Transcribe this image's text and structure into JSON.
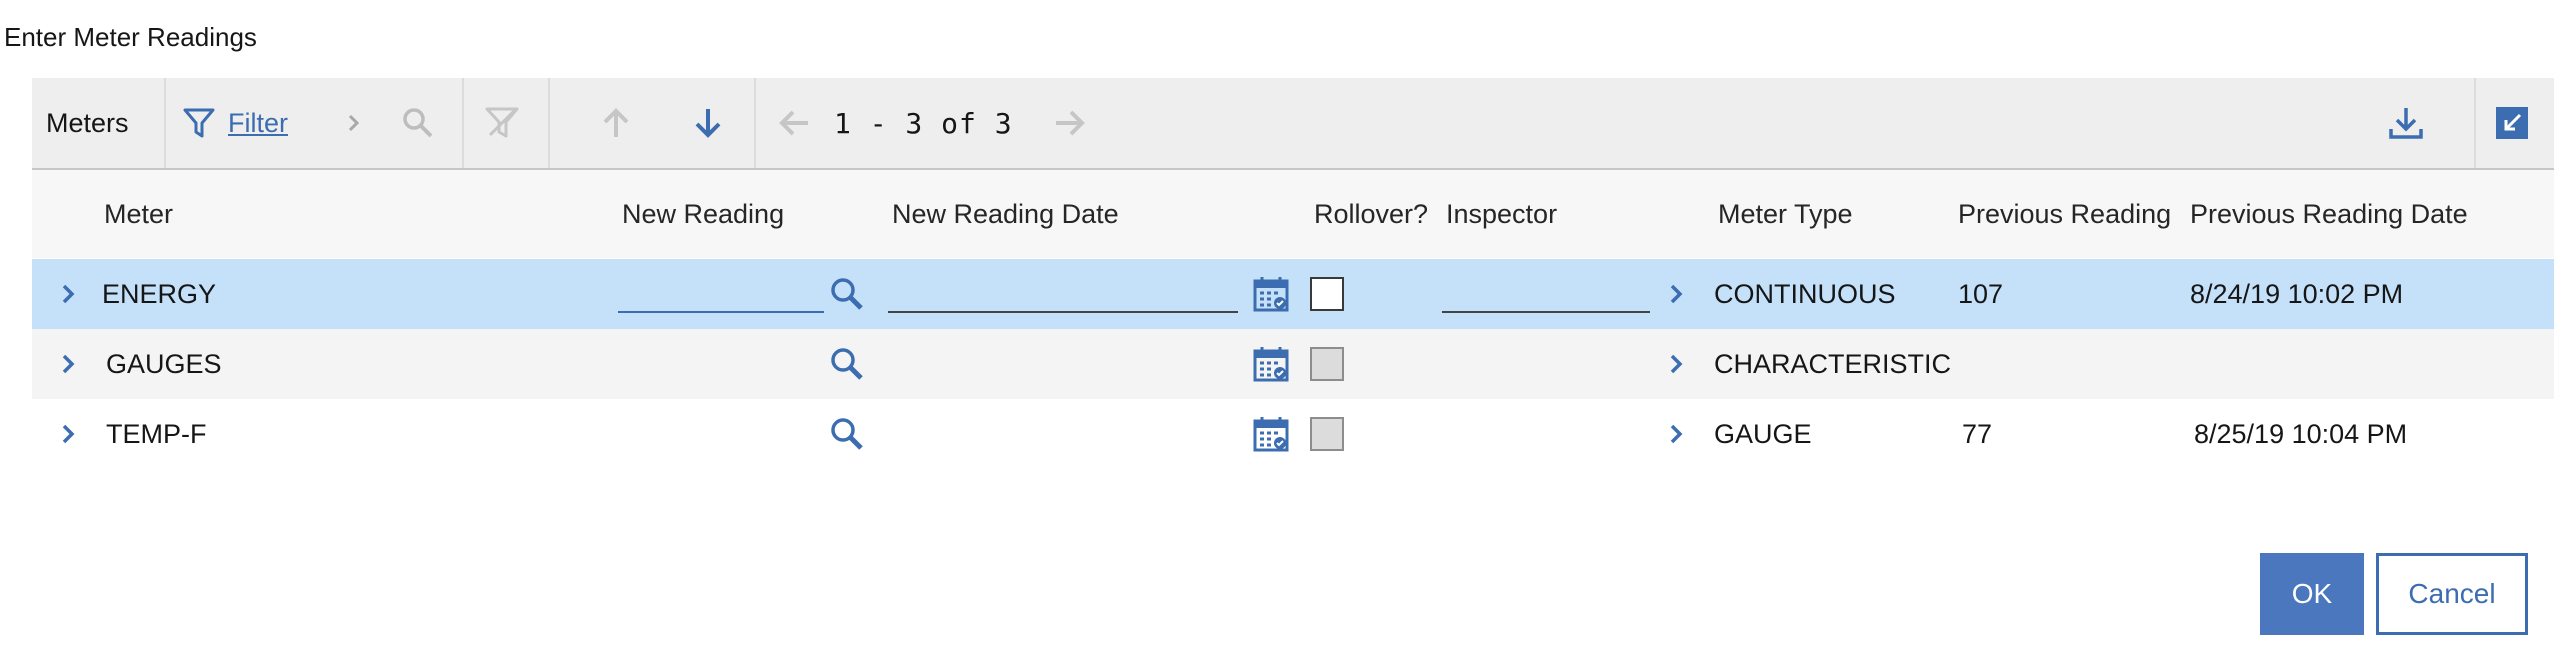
{
  "dialog": {
    "title": "Enter Meter Readings"
  },
  "toolbar": {
    "table_label": "Meters",
    "filter_label": "Filter",
    "pager_text": "1 - 3 of 3"
  },
  "columns": {
    "meter": "Meter",
    "new_reading": "New Reading",
    "new_reading_date": "New Reading Date",
    "rollover": "Rollover?",
    "inspector": "Inspector",
    "meter_type": "Meter Type",
    "previous_reading": "Previous Reading",
    "previous_reading_date": "Previous Reading Date"
  },
  "rows": [
    {
      "meter": "ENERGY",
      "meter_type": "CONTINUOUS",
      "previous_reading": "107",
      "previous_reading_date": "8/24/19 10:02 PM",
      "new_reading": "",
      "new_reading_date": "",
      "inspector": "",
      "rollover": false,
      "selected": true
    },
    {
      "meter": "GAUGES",
      "meter_type": "CHARACTERISTIC",
      "previous_reading": "",
      "previous_reading_date": "",
      "rollover": false,
      "selected": false
    },
    {
      "meter": "TEMP-F",
      "meter_type": "GAUGE",
      "previous_reading": "77",
      "previous_reading_date": "8/25/19 10:04 PM",
      "rollover": false,
      "selected": false
    }
  ],
  "buttons": {
    "ok": "OK",
    "cancel": "Cancel"
  },
  "colors": {
    "accent": "#3c6db0",
    "primary_button": "#4a77be",
    "selected_row": "#c4e1f9",
    "toolbar_bg": "#eeeeee"
  },
  "icons": [
    "filter-icon",
    "chevron-right-icon",
    "search-icon",
    "clear-filter-icon",
    "arrow-up-icon",
    "arrow-down-icon",
    "arrow-left-icon",
    "arrow-right-icon",
    "download-icon",
    "minimize-icon",
    "calendar-icon",
    "expand-row-icon",
    "detail-chevron-icon"
  ]
}
